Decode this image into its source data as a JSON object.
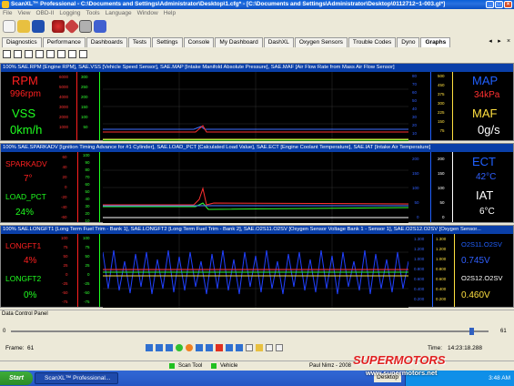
{
  "window": {
    "title": "ScanXL™ Professional - C:\\Documents and Settings\\Administrator\\Desktop\\1.cfg* - [C:\\Documents and Settings\\Administrator\\Desktop\\0112712~1-003.gl*]"
  },
  "menu": [
    "File",
    "View",
    "OBD-II",
    "Logging",
    "Tools",
    "Language",
    "Window",
    "Help"
  ],
  "tabs": [
    {
      "label": "Diagnostics",
      "active": false
    },
    {
      "label": "Performance",
      "active": false
    },
    {
      "label": "Dashboards",
      "active": false
    },
    {
      "label": "Tests",
      "active": false
    },
    {
      "label": "Settings",
      "active": false
    },
    {
      "label": "Console",
      "active": false
    },
    {
      "label": "My Dashboard",
      "active": false
    },
    {
      "label": "DashXL",
      "active": false
    },
    {
      "label": "Oxygen Sensors",
      "active": false
    },
    {
      "label": "Trouble Codes",
      "active": false
    },
    {
      "label": "Dyno",
      "active": false
    },
    {
      "label": "Graphs",
      "active": true
    }
  ],
  "graphs": [
    {
      "header": "100% SAE.RPM [Engine RPM], SAE.VSS [Vehicle Speed Sensor], SAE.MAP [Intake Manifold Absolute Pressure], SAE.MAF [Air Flow Rate from Mass Air Flow Sensor]",
      "left": [
        {
          "name": "RPM",
          "value": "996rpm",
          "color": "#ff2020"
        },
        {
          "name": "VSS",
          "value": "0km/h",
          "color": "#20ff20"
        }
      ],
      "right": [
        {
          "name": "MAP",
          "value": "34kPa",
          "color": "#2060ff"
        },
        {
          "name": "MAF",
          "value": "0g/s",
          "color": "#ffe040"
        }
      ],
      "scales": {
        "a": [
          "6000",
          "5000",
          "4000",
          "3000",
          "2000",
          "1000"
        ],
        "b": [
          "300",
          "250",
          "200",
          "150",
          "100",
          "50"
        ],
        "c": [
          "80",
          "70",
          "60",
          "50",
          "40",
          "30",
          "20",
          "10"
        ],
        "d": [
          "500",
          "450",
          "375",
          "300",
          "225",
          "150",
          "75"
        ]
      }
    },
    {
      "header": "100% SAE.SPARKADV [Ignition Timing Advance for #1 Cylinder], SAE.LOAD_PCT [Calculated Load Value], SAE.ECT [Engine Coolant Temperature], SAE.IAT [Intake Air Temperature]",
      "left": [
        {
          "name": "SPARKADV",
          "value": "7°",
          "color": "#ff2020"
        },
        {
          "name": "LOAD_PCT",
          "value": "24%",
          "color": "#20ff20"
        }
      ],
      "right": [
        {
          "name": "ECT",
          "value": "42°C",
          "color": "#2060ff"
        },
        {
          "name": "IAT",
          "value": "6°C",
          "color": "#ffffff"
        }
      ],
      "scales": {
        "a": [
          "60",
          "40",
          "20",
          "0",
          "-20",
          "-40",
          "-60"
        ],
        "b": [
          "100",
          "90",
          "80",
          "70",
          "60",
          "50",
          "40",
          "30",
          "20",
          "10"
        ],
        "c": [
          "200",
          "150",
          "100",
          "50",
          "0"
        ],
        "d": [
          "200",
          "150",
          "100",
          "50",
          "0"
        ]
      }
    },
    {
      "header": "100% SAE.LONGFT1 [Long Term Fuel Trim - Bank 1], SAE.LONGFT2 [Long Term Fuel Trim - Bank 2], SAE.O2S11.O2SV [Oxygen Sensor Voltage Bank 1 - Sensor 1], SAE.O2S12.O2SV [Oxygen Sensor...",
      "left": [
        {
          "name": "LONGFT1",
          "value": "4%",
          "color": "#ff2020"
        },
        {
          "name": "LONGFT2",
          "value": "0%",
          "color": "#20ff20"
        }
      ],
      "right": [
        {
          "name": "O2S11.O2SV",
          "value": "0.745V",
          "color": "#2060ff"
        },
        {
          "name": "O2S12.O2SV",
          "value": "0.460V",
          "color": "#ffe040"
        }
      ],
      "scales": {
        "a": [
          "100",
          "75",
          "50",
          "25",
          "0",
          "-25",
          "-50",
          "-75"
        ],
        "b": [
          "100",
          "75",
          "50",
          "25",
          "0",
          "-25",
          "-50",
          "-75"
        ],
        "c": [
          "1.300",
          "1.200",
          "1.000",
          "0.800",
          "0.600",
          "0.400",
          "0.200"
        ],
        "d": [
          "1.300",
          "1.200",
          "1.000",
          "0.800",
          "0.600",
          "0.400",
          "0.200"
        ]
      }
    }
  ],
  "data_control": {
    "title": "Data Control Panel",
    "slider_start": "0",
    "slider_end": "61",
    "frame_label": "Frame:",
    "frame_value": "61",
    "time_label": "Time:",
    "time_value": "14:23:18.288",
    "slider_position": 0.97
  },
  "status": {
    "scan_tool": "Scan Tool",
    "vehicle": "Vehicle",
    "user": "Paul Nimz - 2008"
  },
  "taskbar": {
    "start": "Start",
    "item": "ScanXL™ Professional...",
    "desktop": "Desktop",
    "clock": "3:48 AM"
  },
  "watermark": {
    "name": "SUPERMOTORS",
    "url": "www.supermotors.net"
  }
}
